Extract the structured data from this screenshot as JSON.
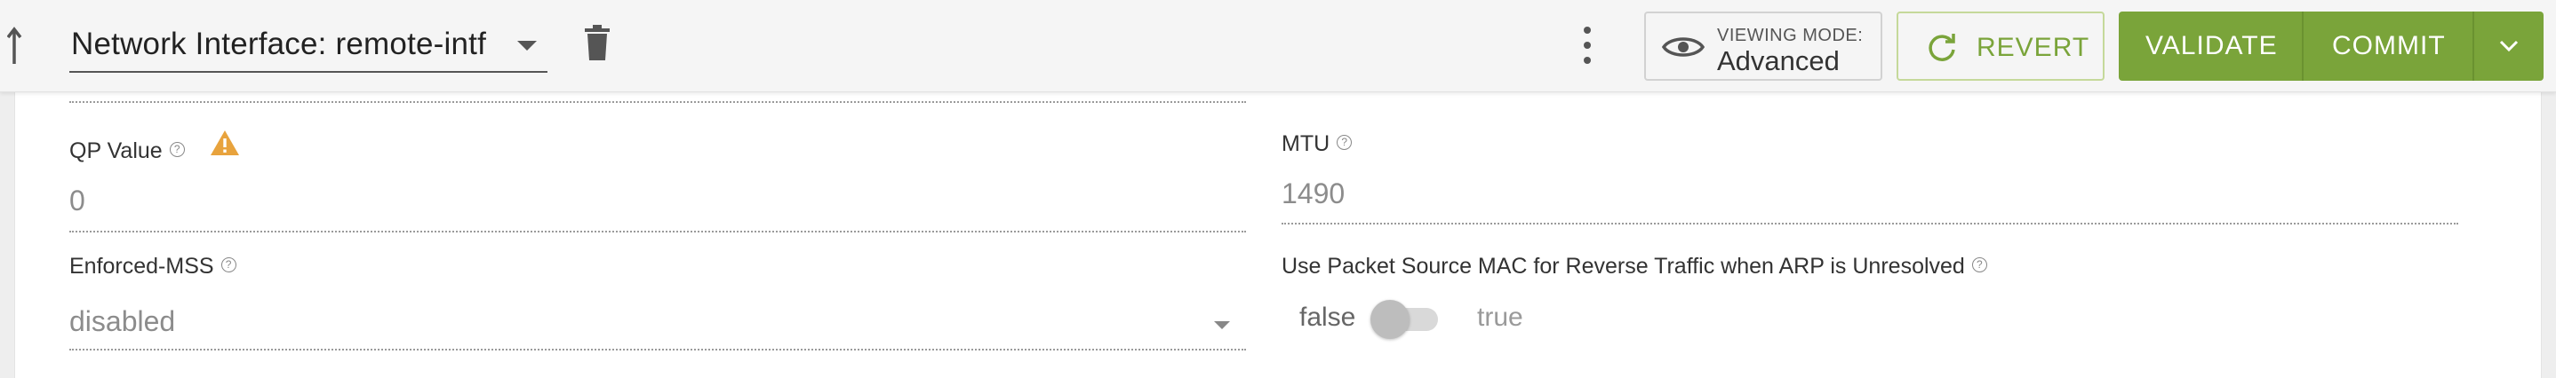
{
  "header": {
    "title": "Network Interface: remote-intf",
    "viewing_mode_label": "VIEWING MODE:",
    "viewing_mode_value": "Advanced",
    "revert_label": "REVERT",
    "validate_label": "VALIDATE",
    "commit_label": "COMMIT"
  },
  "fields": {
    "qp_value": {
      "label": "QP Value",
      "value": "0"
    },
    "mtu": {
      "label": "MTU",
      "value": "1490"
    },
    "enforced_mss": {
      "label": "Enforced-MSS",
      "value": "disabled"
    },
    "use_packet_source_mac": {
      "label": "Use Packet Source MAC for Reverse Traffic when ARP is Unresolved",
      "false_label": "false",
      "true_label": "true",
      "checked": false
    }
  },
  "help_glyph": "?",
  "colors": {
    "accent": "#7aa43a",
    "warning": "#e8a33d"
  }
}
